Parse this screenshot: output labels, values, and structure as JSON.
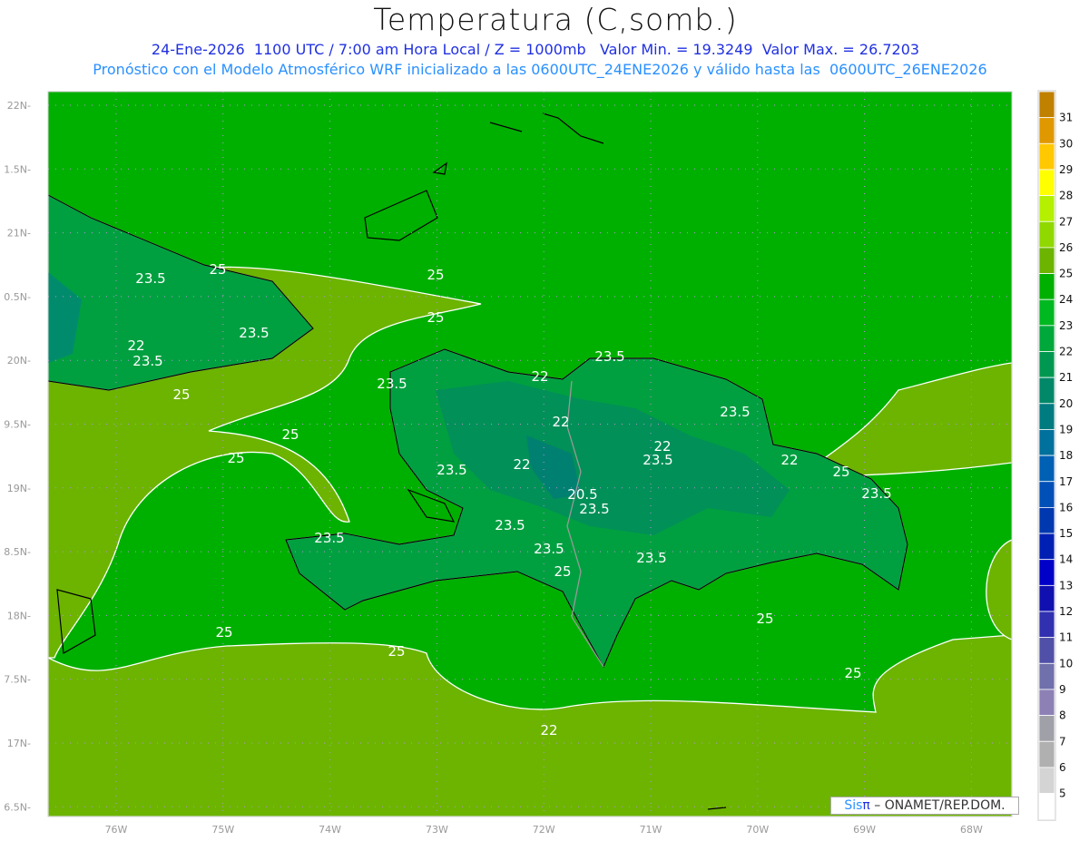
{
  "header": {
    "title": "Temperatura (C,somb.)",
    "line1": "24-Ene-2026  1100 UTC / 7:00 am Hora Local / Z = 1000mb   Valor Min. = 19.3249  Valor Max. = 26.7203",
    "line2": "Pronóstico con el Modelo Atmosférico WRF inicializado a las 0600UTC_24ENE2026 y válido hasta las  0600UTC_26ENE2026"
  },
  "axes": {
    "lon_labels": [
      "76W",
      "75W",
      "74W",
      "73W",
      "72W",
      "71W",
      "70W",
      "69W",
      "68W"
    ],
    "lat_labels": [
      "22N",
      "1.5N",
      "21N",
      "0.5N",
      "20N",
      "9.5N",
      "19N",
      "8.5N",
      "18N",
      "7.5N",
      "17N",
      "6.5N"
    ]
  },
  "colorbar": {
    "labels": [
      "31",
      "30",
      "29",
      "28",
      "27",
      "26",
      "25",
      "24",
      "23",
      "22",
      "21",
      "20",
      "19",
      "18",
      "17",
      "16",
      "15",
      "14",
      "13",
      "12",
      "11",
      "10",
      "9",
      "8",
      "7",
      "6",
      "5"
    ],
    "colors": [
      "#c08000",
      "#e09800",
      "#ffc800",
      "#ffff00",
      "#b4f000",
      "#90d800",
      "#6cb400",
      "#00b000",
      "#00b820",
      "#00a83c",
      "#009850",
      "#008868",
      "#007c80",
      "#00709c",
      "#0060b4",
      "#0050b8",
      "#0038b0",
      "#0020b4",
      "#0000c8",
      "#1010b0",
      "#3030b0",
      "#5050a8",
      "#7070ac",
      "#8c80b4",
      "#a0a0a8",
      "#b0b0b0",
      "#d4d4d4",
      "#ffffff"
    ]
  },
  "contour_labels": [
    "25",
    "23.5",
    "25",
    "25",
    "22",
    "23.5",
    "23.5",
    "25",
    "23.5",
    "25",
    "25",
    "23.5",
    "22",
    "22",
    "23.5",
    "22",
    "22",
    "23.5",
    "23.5",
    "22",
    "25",
    "20.5",
    "23.5",
    "23.5",
    "23.5",
    "23.5",
    "25",
    "23.5",
    "23.5",
    "25",
    "25",
    "25",
    "25",
    "22"
  ],
  "credit": {
    "sis": "Sis",
    "pi": "π",
    "rest": " – ONAMET/REP.DOM."
  }
}
